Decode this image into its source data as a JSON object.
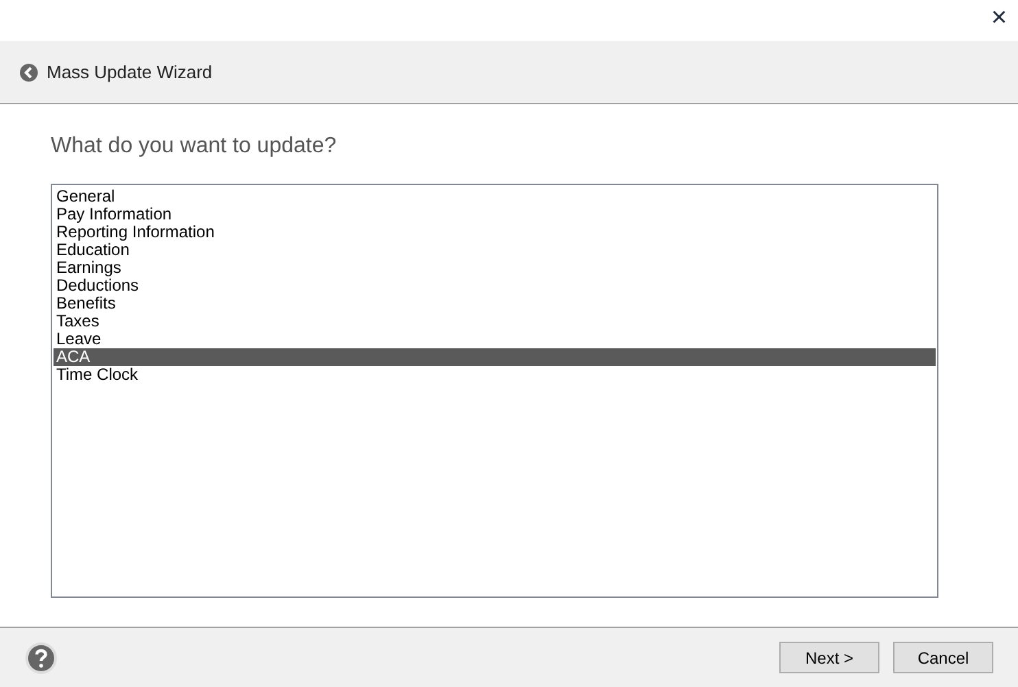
{
  "window": {
    "close": "×"
  },
  "header": {
    "title": "Mass Update Wizard"
  },
  "prompt": "What do you want to update?",
  "list": [
    {
      "label": "General",
      "selected": false
    },
    {
      "label": "Pay Information",
      "selected": false
    },
    {
      "label": "Reporting Information",
      "selected": false
    },
    {
      "label": "Education",
      "selected": false
    },
    {
      "label": "Earnings",
      "selected": false
    },
    {
      "label": "Deductions",
      "selected": false
    },
    {
      "label": "Benefits",
      "selected": false
    },
    {
      "label": "Taxes",
      "selected": false
    },
    {
      "label": "Leave",
      "selected": false
    },
    {
      "label": "ACA",
      "selected": true
    },
    {
      "label": "Time Clock",
      "selected": false
    }
  ],
  "buttons": [
    {
      "label": "Next >"
    },
    {
      "label": "Cancel"
    }
  ]
}
